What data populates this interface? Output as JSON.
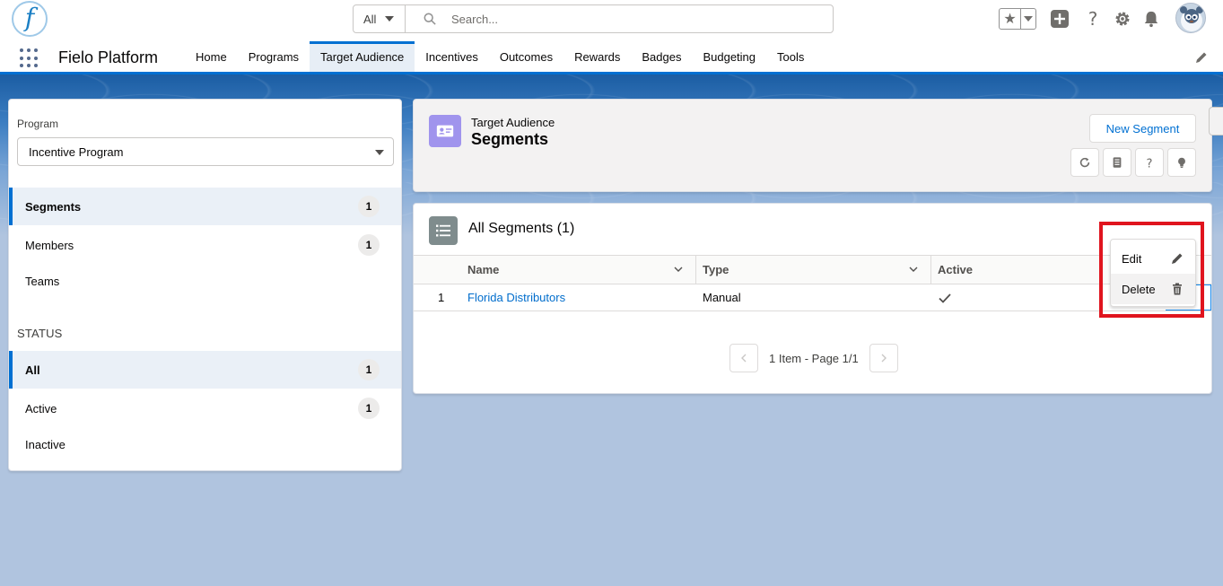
{
  "header": {
    "logo_letter": "f",
    "search_scope": "All",
    "search_placeholder": "Search..."
  },
  "nav": {
    "app_name": "Fielo Platform",
    "items": [
      {
        "label": "Home",
        "active": false
      },
      {
        "label": "Programs",
        "active": false
      },
      {
        "label": "Target Audience",
        "active": true
      },
      {
        "label": "Incentives",
        "active": false
      },
      {
        "label": "Outcomes",
        "active": false
      },
      {
        "label": "Rewards",
        "active": false
      },
      {
        "label": "Badges",
        "active": false
      },
      {
        "label": "Budgeting",
        "active": false
      },
      {
        "label": "Tools",
        "active": false
      }
    ]
  },
  "sidebar": {
    "program_label": "Program",
    "program_value": "Incentive Program",
    "views": [
      {
        "label": "Segments",
        "count": "1",
        "selected": true
      },
      {
        "label": "Members",
        "count": "1",
        "selected": false
      },
      {
        "label": "Teams",
        "count": "",
        "selected": false
      }
    ],
    "status_heading": "STATUS",
    "statuses": [
      {
        "label": "All",
        "count": "1",
        "selected": true
      },
      {
        "label": "Active",
        "count": "1",
        "selected": false
      },
      {
        "label": "Inactive",
        "count": "",
        "selected": false
      }
    ]
  },
  "page_header": {
    "object_label": "Target Audience",
    "title": "Segments",
    "new_button": "New Segment"
  },
  "list": {
    "title": "All Segments (1)",
    "columns": [
      "Name",
      "Type",
      "Active"
    ],
    "rows": [
      {
        "index": "1",
        "name": "Florida Distributors",
        "type": "Manual",
        "active": true
      }
    ],
    "pager_text": "1 Item - Page 1/1"
  },
  "row_menu": {
    "items": [
      {
        "label": "Edit",
        "icon": "pencil-icon"
      },
      {
        "label": "Delete",
        "icon": "trash-icon"
      }
    ]
  },
  "colors": {
    "brand": "#0070d2",
    "highlight": "#e0141e",
    "segment_icon": "#a094ed"
  }
}
